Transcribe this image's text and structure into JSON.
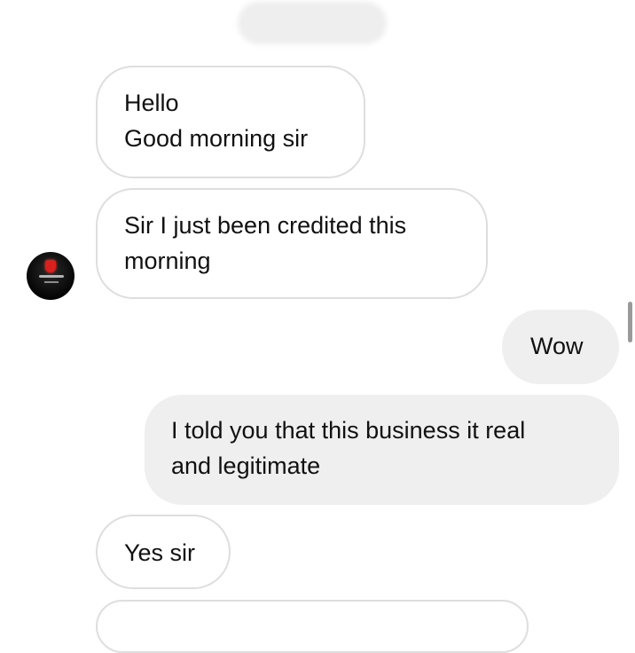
{
  "chat": {
    "contact_name": "",
    "contact_avatar": "profile-logo-avatar",
    "messages": [
      {
        "direction": "incoming",
        "lines": [
          "Hello",
          "Good morning sir"
        ]
      },
      {
        "direction": "incoming",
        "lines": [
          "Sir I just been credited this",
          "morning"
        ]
      },
      {
        "direction": "outgoing",
        "lines": [
          "Wow"
        ]
      },
      {
        "direction": "outgoing",
        "lines": [
          "I told you that this business it real",
          "and legitimate"
        ]
      },
      {
        "direction": "incoming",
        "lines": [
          "Yes sir"
        ]
      }
    ]
  },
  "colors": {
    "incoming_bubble": "#ffffff",
    "incoming_border": "#dedede",
    "outgoing_bubble": "#efefef",
    "text": "#111111"
  }
}
